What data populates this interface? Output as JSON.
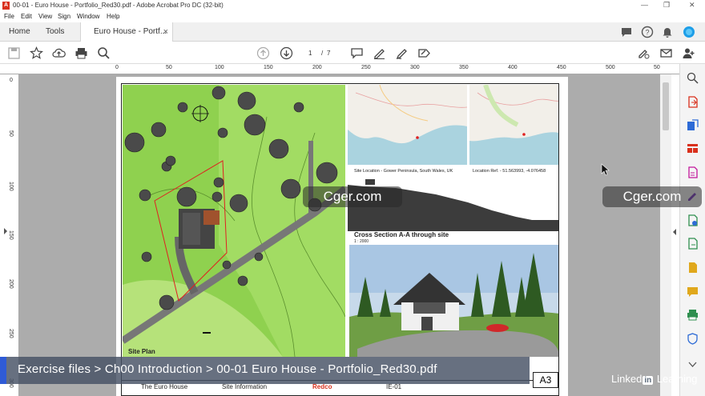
{
  "window": {
    "title": "00-01 - Euro House - Portfolio_Red30.pdf - Adobe Acrobat Pro DC (32-bit)",
    "app_icon_letter": "A",
    "controls": {
      "minimize": "—",
      "maximize": "❐",
      "close": "✕"
    }
  },
  "menu": [
    "File",
    "Edit",
    "View",
    "Sign",
    "Window",
    "Help"
  ],
  "tabs": {
    "home": "Home",
    "tools": "Tools",
    "document": "Euro House - Portf...",
    "close": "×"
  },
  "toolbar": {
    "page_current": "1",
    "page_separator": "/",
    "page_total": "7"
  },
  "ruler": {
    "top_ticks": [
      "0",
      "50",
      "100",
      "150",
      "200",
      "250",
      "300",
      "350",
      "400",
      "450",
      "500",
      "50"
    ],
    "left_ticks": [
      "0",
      "50",
      "100",
      "150",
      "200",
      "250",
      "300"
    ]
  },
  "sheet": {
    "site_location": "Site Location - Gower Peninsula, South Wales, UK",
    "location_ref": "Location Ref. - 51.563993, -4.076458",
    "cross_section_title": "Cross Section A-A through site",
    "cross_section_scale": "1 : 2000",
    "site_plan_label": "Site Plan",
    "footer_cells": [
      "The Euro House",
      "Site Information",
      "Redco",
      "IE-01"
    ],
    "sheet_size": "A3"
  },
  "watermarks": [
    "Cger.com",
    "Cger.com"
  ],
  "caption": "Exercise files >  Ch00 Introduction > 00-01 Euro House - Portfolio_Red30.pdf",
  "branding": {
    "linkedin_pre": "Linked",
    "linkedin_in": "in",
    "linkedin_post": " Learning"
  },
  "colors": {
    "accent_red": "#d9301c",
    "caption_bar": "#2f5bd6",
    "site_green": "#8fd14f"
  }
}
